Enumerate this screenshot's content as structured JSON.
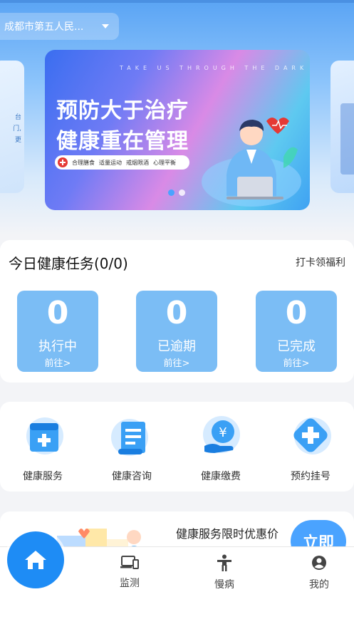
{
  "location": {
    "city": "成都市第五人民..."
  },
  "banner": {
    "tagline": "TAKE US THROUGH THE DARK",
    "line1": "预防大于治疗",
    "line2": "健康重在管理",
    "tags": [
      "合理膳食",
      "适量运动",
      "戒烟限酒",
      "心理平衡"
    ],
    "slide_count": 2,
    "active_slide": 1
  },
  "side_left": {
    "text_a": "台",
    "text_b": "门,",
    "text_c": "更"
  },
  "tasks": {
    "title": "今日健康任务(0/0)",
    "link": "打卡领福利",
    "items": [
      {
        "count": "0",
        "label": "执行中",
        "go": "前往>"
      },
      {
        "count": "0",
        "label": "已逾期",
        "go": "前往>"
      },
      {
        "count": "0",
        "label": "已完成",
        "go": "前往>"
      }
    ]
  },
  "services": {
    "items": [
      {
        "label": "健康服务",
        "icon": "medical-kit-icon"
      },
      {
        "label": "健康咨询",
        "icon": "document-scroll-icon"
      },
      {
        "label": "健康缴费",
        "icon": "yuan-payment-icon"
      },
      {
        "label": "预约挂号",
        "icon": "medical-cross-icon"
      }
    ]
  },
  "promo": {
    "text": "健康服务限时优惠价",
    "button": "立即"
  },
  "tabbar": {
    "items": [
      {
        "label": "首页",
        "icon": "home-icon"
      },
      {
        "label": "监测",
        "icon": "devices-icon"
      },
      {
        "label": "慢病",
        "icon": "person-icon"
      },
      {
        "label": "我的",
        "icon": "account-icon"
      }
    ]
  },
  "colors": {
    "primary": "#1e8cf5",
    "task_box": "#7bbdf5",
    "header": "#5aa4f4"
  }
}
